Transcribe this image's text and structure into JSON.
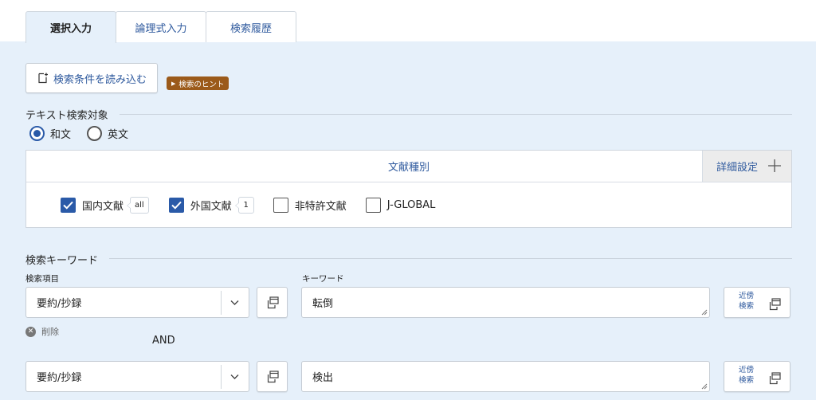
{
  "tabs": [
    {
      "label": "選択入力",
      "active": true
    },
    {
      "label": "論理式入力",
      "active": false
    },
    {
      "label": "検索履歴",
      "active": false
    }
  ],
  "load_button": {
    "label": "検索条件を読み込む",
    "icon": "load-file-icon"
  },
  "hint_badge": {
    "label": "検索のヒント",
    "color": "#9b5a1a"
  },
  "text_target": {
    "title": "テキスト検索対象",
    "options": [
      {
        "label": "和文",
        "selected": true
      },
      {
        "label": "英文",
        "selected": false
      }
    ]
  },
  "doc_type": {
    "title": "文献種別",
    "detail_label": "詳細設定",
    "items": [
      {
        "label": "国内文献",
        "checked": true,
        "count": "all"
      },
      {
        "label": "外国文献",
        "checked": true,
        "count": "1"
      },
      {
        "label": "非特許文献",
        "checked": false
      },
      {
        "label": "J-GLOBAL",
        "checked": false
      }
    ]
  },
  "keyword_section": {
    "title": "検索キーワード",
    "field_label": "検索項目",
    "keyword_label": "キーワード",
    "rows": [
      {
        "field": "要約/抄録",
        "keyword": "転倒",
        "near_label_1": "近傍",
        "near_label_2": "検索"
      },
      {
        "field": "要約/抄録",
        "keyword": "検出",
        "near_label_1": "近傍",
        "near_label_2": "検索"
      }
    ],
    "delete_label": "削除",
    "operator": "AND"
  },
  "colors": {
    "accent": "#2a5aa8",
    "panel": "#e6f0fa",
    "link": "#2f5a9e"
  }
}
